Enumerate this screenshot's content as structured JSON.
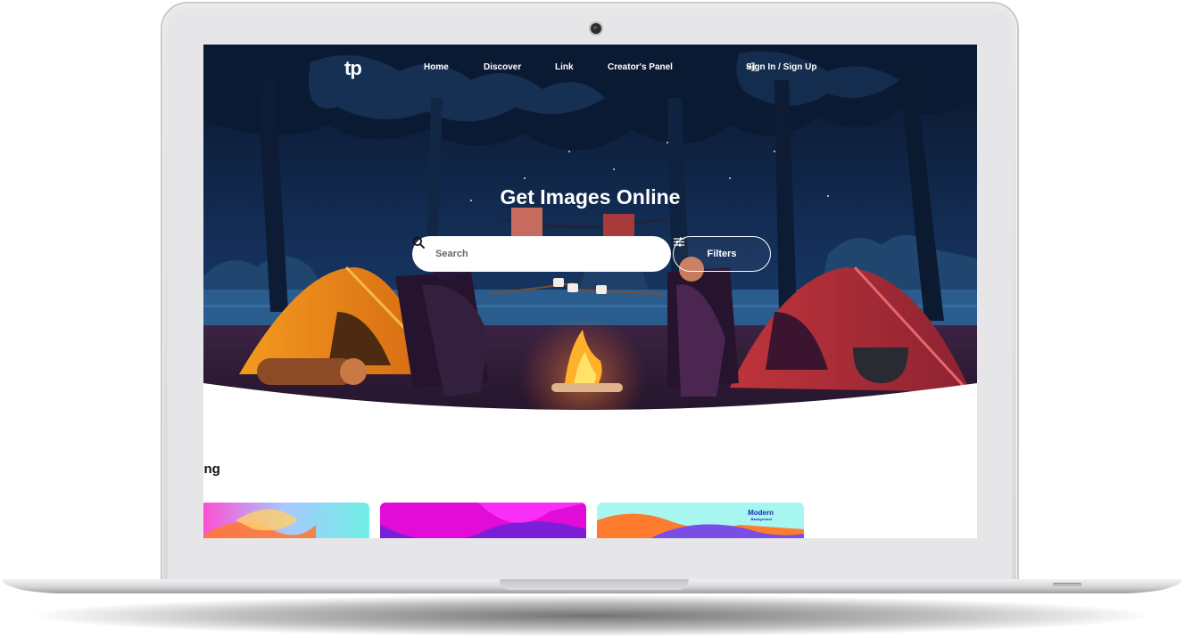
{
  "nav": {
    "logo": "tp",
    "links": [
      "Home",
      "Discover",
      "Link",
      "Creator's Panel"
    ],
    "signin": "Sign In / Sign Up"
  },
  "hero": {
    "title": "Get Images Online"
  },
  "search": {
    "placeholder": "Search",
    "value": ""
  },
  "filters": {
    "label": "Filters"
  },
  "trending": {
    "title": "nding",
    "cards": [
      {
        "label": ""
      },
      {
        "label": ""
      },
      {
        "label": "Modern",
        "sublabel": "Background"
      }
    ]
  },
  "colors": {
    "hero_night": "#0e1b35",
    "accent_blue": "#1b2fb7",
    "text_dark": "#111111"
  },
  "icons": {
    "search": "search-icon",
    "filters": "sliders-icon",
    "signin": "sign-in-icon"
  }
}
